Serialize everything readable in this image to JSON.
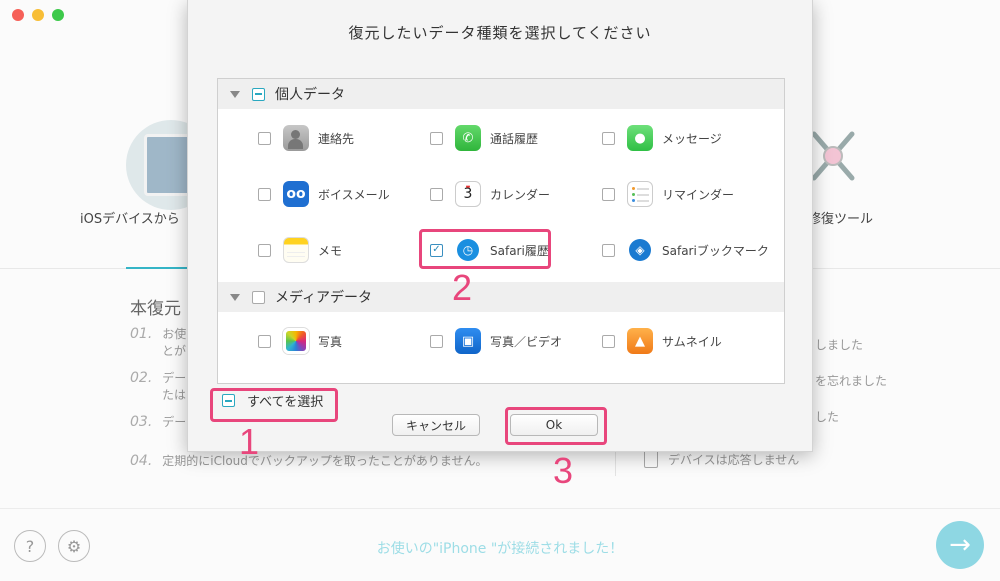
{
  "background": {
    "left_option_label": "iOSデバイスから",
    "right_option_label": "修復ツール",
    "section_heading": "本復元",
    "list_items": [
      {
        "num": "01.",
        "text": "お使",
        "text2": "とが"
      },
      {
        "num": "02.",
        "text": "デー",
        "text2": "たは"
      },
      {
        "num": "03.",
        "text": "デー"
      }
    ],
    "list_item4": {
      "num": "04.",
      "text": "定期的にiCloudでバックアップを取ったことがありません。"
    },
    "right_list": [
      "しました",
      "を忘れました",
      "した"
    ],
    "right_last": "デバイスは応答しません",
    "status_message": "お使いの\"iPhone \"が接続されました！",
    "help_icon": "question-icon",
    "settings_icon": "gear-icon",
    "next_icon": "arrow-right-icon"
  },
  "dialog": {
    "title": "復元したいデータ種類を選択してください",
    "sections": [
      {
        "label": "個人データ",
        "state": "partial",
        "items": [
          {
            "label": "連絡先",
            "icon": "contacts-icon",
            "checked": false
          },
          {
            "label": "通話履歴",
            "icon": "phone-icon",
            "checked": false
          },
          {
            "label": "メッセージ",
            "icon": "messages-icon",
            "checked": false
          },
          {
            "label": "ボイスメール",
            "icon": "voicemail-icon",
            "checked": false
          },
          {
            "label": "カレンダー",
            "icon": "calendar-icon",
            "checked": false
          },
          {
            "label": "リマインダー",
            "icon": "reminders-icon",
            "checked": false
          },
          {
            "label": "メモ",
            "icon": "notes-icon",
            "checked": false
          },
          {
            "label": "Safari履歴",
            "icon": "safari-history-icon",
            "checked": true
          },
          {
            "label": "Safariブックマーク",
            "icon": "safari-bookmark-icon",
            "checked": false
          }
        ]
      },
      {
        "label": "メディアデータ",
        "state": "unchecked",
        "items": [
          {
            "label": "写真",
            "icon": "photos-icon",
            "checked": false
          },
          {
            "label": "写真／ビデオ",
            "icon": "photo-video-icon",
            "checked": false
          },
          {
            "label": "サムネイル",
            "icon": "thumbnail-icon",
            "checked": false
          }
        ]
      }
    ],
    "calendar_day": "3",
    "select_all_label": "すべてを選択",
    "cancel_label": "キャンセル",
    "ok_label": "Ok"
  },
  "annotations": [
    "1",
    "2",
    "3"
  ],
  "colors": {
    "accent": "#35b5c7",
    "annotation": "#e8467c",
    "checkbox_partial": "#2aa8c0"
  }
}
